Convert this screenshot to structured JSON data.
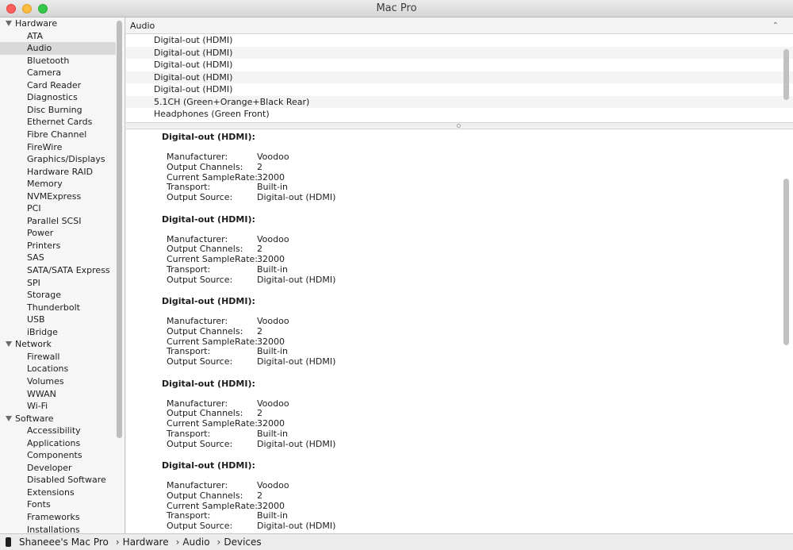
{
  "window": {
    "title": "Mac Pro"
  },
  "sidebar": {
    "groups": [
      {
        "label": "Hardware",
        "items": [
          "ATA",
          "Audio",
          "Bluetooth",
          "Camera",
          "Card Reader",
          "Diagnostics",
          "Disc Burning",
          "Ethernet Cards",
          "Fibre Channel",
          "FireWire",
          "Graphics/Displays",
          "Hardware RAID",
          "Memory",
          "NVMExpress",
          "PCI",
          "Parallel SCSI",
          "Power",
          "Printers",
          "SAS",
          "SATA/SATA Express",
          "SPI",
          "Storage",
          "Thunderbolt",
          "USB",
          "iBridge"
        ]
      },
      {
        "label": "Network",
        "items": [
          "Firewall",
          "Locations",
          "Volumes",
          "WWAN",
          "Wi-Fi"
        ]
      },
      {
        "label": "Software",
        "items": [
          "Accessibility",
          "Applications",
          "Components",
          "Developer",
          "Disabled Software",
          "Extensions",
          "Fonts",
          "Frameworks",
          "Installations"
        ]
      }
    ],
    "selected": "Audio"
  },
  "list": {
    "header": "Audio",
    "rows": [
      "Digital-out (HDMI)",
      "Digital-out (HDMI)",
      "Digital-out (HDMI)",
      "Digital-out (HDMI)",
      "Digital-out (HDMI)",
      "5.1CH (Green+Orange+Black Rear)",
      "Headphones (Green Front)"
    ]
  },
  "detail": {
    "devices": [
      {
        "title": "Digital-out (HDMI):",
        "props": [
          [
            "Manufacturer:",
            "Voodoo"
          ],
          [
            "Output Channels:",
            "2"
          ],
          [
            "Current SampleRate:",
            "32000"
          ],
          [
            "Transport:",
            "Built-in"
          ],
          [
            "Output Source:",
            "Digital-out (HDMI)"
          ]
        ]
      },
      {
        "title": "Digital-out (HDMI):",
        "props": [
          [
            "Manufacturer:",
            "Voodoo"
          ],
          [
            "Output Channels:",
            "2"
          ],
          [
            "Current SampleRate:",
            "32000"
          ],
          [
            "Transport:",
            "Built-in"
          ],
          [
            "Output Source:",
            "Digital-out (HDMI)"
          ]
        ]
      },
      {
        "title": "Digital-out (HDMI):",
        "props": [
          [
            "Manufacturer:",
            "Voodoo"
          ],
          [
            "Output Channels:",
            "2"
          ],
          [
            "Current SampleRate:",
            "32000"
          ],
          [
            "Transport:",
            "Built-in"
          ],
          [
            "Output Source:",
            "Digital-out (HDMI)"
          ]
        ]
      },
      {
        "title": "Digital-out (HDMI):",
        "props": [
          [
            "Manufacturer:",
            "Voodoo"
          ],
          [
            "Output Channels:",
            "2"
          ],
          [
            "Current SampleRate:",
            "32000"
          ],
          [
            "Transport:",
            "Built-in"
          ],
          [
            "Output Source:",
            "Digital-out (HDMI)"
          ]
        ]
      },
      {
        "title": "Digital-out (HDMI):",
        "props": [
          [
            "Manufacturer:",
            "Voodoo"
          ],
          [
            "Output Channels:",
            "2"
          ],
          [
            "Current SampleRate:",
            "32000"
          ],
          [
            "Transport:",
            "Built-in"
          ],
          [
            "Output Source:",
            "Digital-out (HDMI)"
          ]
        ]
      }
    ]
  },
  "statusbar": {
    "icon": "mac-pro-icon",
    "path": [
      "Shaneee's Mac Pro",
      "Hardware",
      "Audio",
      "Devices"
    ]
  },
  "colors": {
    "close": "#fc605c",
    "minimize": "#fdbc40",
    "maximize": "#34c84a",
    "selection": "#d9d9d9"
  }
}
